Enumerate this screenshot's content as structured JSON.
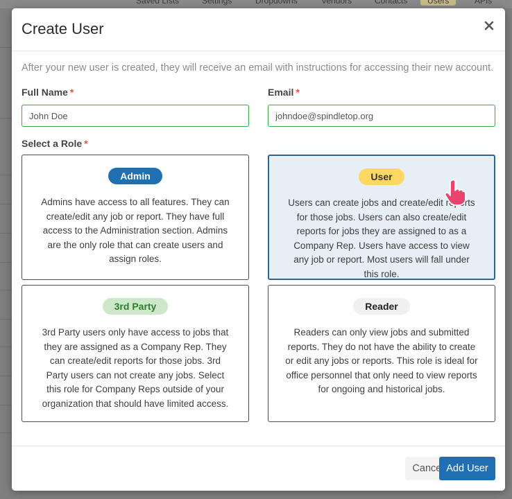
{
  "background": {
    "tabs": [
      "Saved Lists",
      "Settings",
      "Dropdowns",
      "Vendors",
      "Contacts",
      "Users",
      "APIs"
    ],
    "active_tab": "Users"
  },
  "modal": {
    "title": "Create User",
    "close_icon": "close-icon",
    "intro_text": "After your new user is created, they will receive an email with instructions for accessing their new account."
  },
  "form": {
    "full_name": {
      "label": "Full Name",
      "required_mark": "*",
      "value": "John Doe"
    },
    "email": {
      "label": "Email",
      "required_mark": "*",
      "value": "johndoe@spindletop.org"
    },
    "role_label": "Select a Role",
    "role_required_mark": "*"
  },
  "roles": [
    {
      "name": "Admin",
      "badge_bg": "#1f6fb2",
      "badge_fg": "#ffffff",
      "selected": false,
      "description": "Admins have access to all features. They can create/edit any job or report. They have full access to the Administration section. Admins are the only role that can create users and assign roles."
    },
    {
      "name": "User",
      "badge_bg": "#ffd864",
      "badge_fg": "#333333",
      "selected": true,
      "description": "Users can create jobs and create/edit reports for those jobs. Users can also create/edit reports for jobs they are assigned to as a Company Rep. Users have access to view any job or report. Most users will fall under this role."
    },
    {
      "name": "3rd Party",
      "badge_bg": "#cde8c9",
      "badge_fg": "#2e7d32",
      "selected": false,
      "description": "3rd Party users only have access to jobs that they are assigned as a Company Rep. They can create/edit reports for those jobs. 3rd Party users can not create any jobs. Select this role for Company Reps outside of your organization that should have limited access."
    },
    {
      "name": "Reader",
      "badge_bg": "#f0f0f0",
      "badge_fg": "#222222",
      "selected": false,
      "description": "Readers can only view jobs and submitted reports. They do not have the ability to create or edit any jobs or reports. This role is ideal for office personnel that only need to view reports for ongoing and historical jobs."
    }
  ],
  "footer": {
    "cancel_label": "Cancel",
    "add_label": "Add User"
  },
  "colors": {
    "accent": "#1f6fb2",
    "input_border": "#39a845",
    "selected_border": "#2f6395",
    "selected_bg": "#e6eef6",
    "required": "#d9534f"
  },
  "cursor_icon": "hand-pointer-icon"
}
